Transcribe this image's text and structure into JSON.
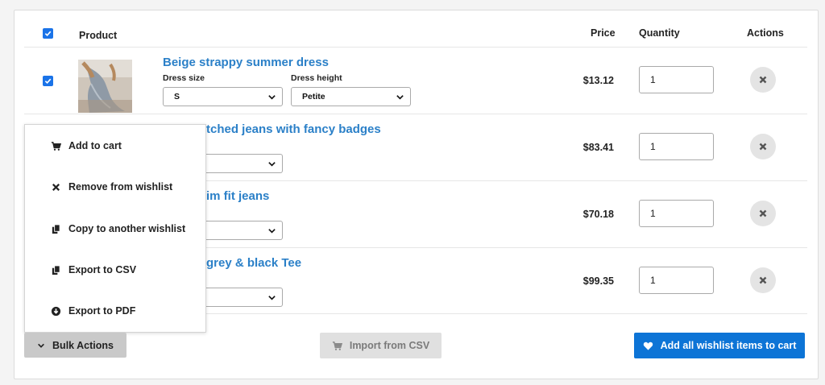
{
  "table": {
    "headers": {
      "product": "Product",
      "price": "Price",
      "quantity": "Quantity",
      "actions": "Actions"
    },
    "rows": [
      {
        "title": "Beige strappy summer dress",
        "price": "$13.12",
        "quantity": "1",
        "checked": true,
        "options": [
          {
            "label": "Dress size",
            "value": "S"
          },
          {
            "label": "Dress height",
            "value": "Petite"
          }
        ]
      },
      {
        "title": "tched jeans with fancy badges",
        "price": "$83.41",
        "quantity": "1"
      },
      {
        "title": "im fit jeans",
        "price": "$70.18",
        "quantity": "1"
      },
      {
        "title": "grey & black Tee",
        "price": "$99.35",
        "quantity": "1"
      }
    ]
  },
  "bulk_menu": {
    "items": [
      {
        "label": "Add to cart",
        "icon": "cart-icon"
      },
      {
        "label": "Remove from wishlist",
        "icon": "close-icon"
      },
      {
        "label": "Copy to another wishlist",
        "icon": "copy-icon"
      },
      {
        "label": "Export to CSV",
        "icon": "copy-icon"
      },
      {
        "label": "Export to PDF",
        "icon": "download-circle-icon"
      }
    ]
  },
  "buttons": {
    "bulk_actions": "Bulk Actions",
    "import_csv": "Import from CSV",
    "add_all": "Add all wishlist items to cart"
  },
  "colors": {
    "link": "#2b80c8",
    "primary": "#0d74d6",
    "checkbox": "#1a73e8"
  }
}
